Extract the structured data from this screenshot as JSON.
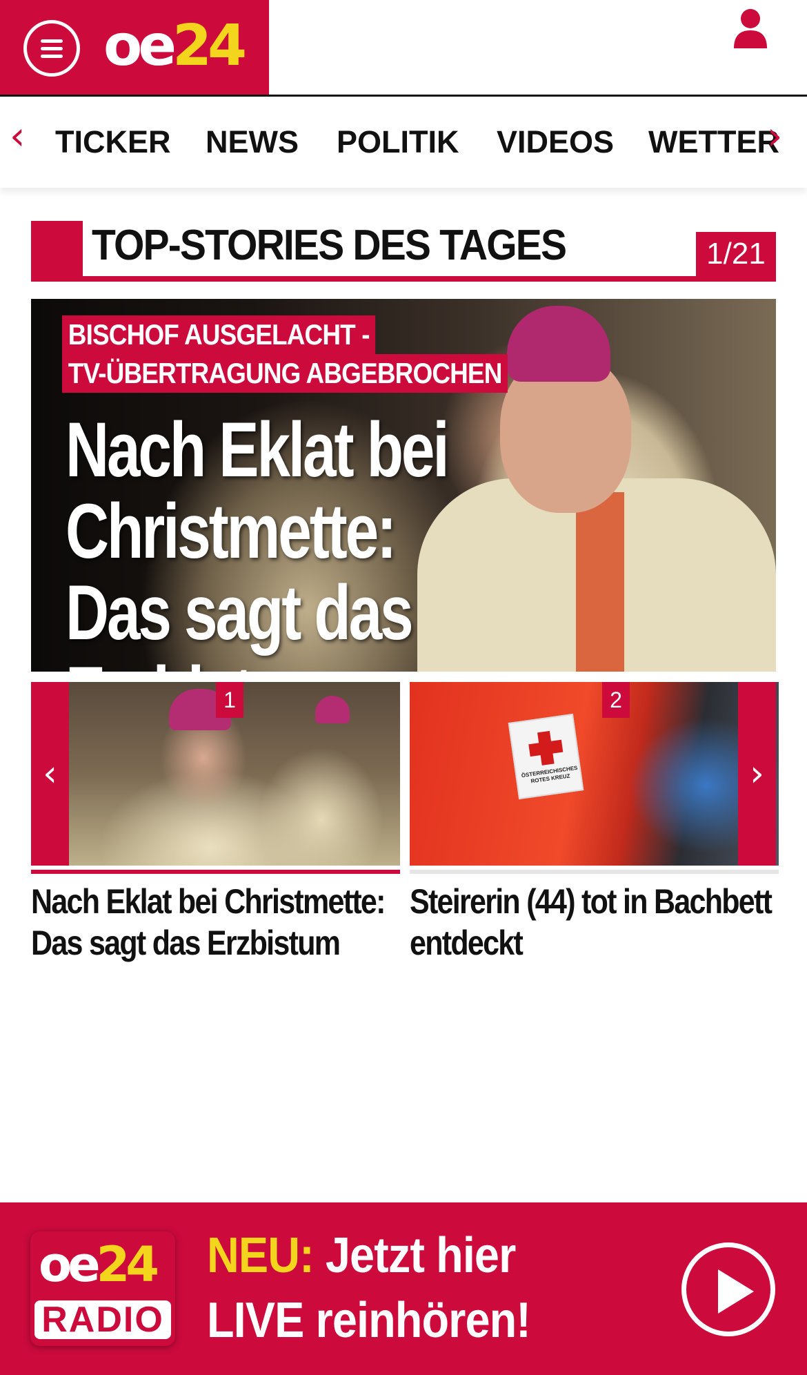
{
  "header": {
    "logo_oe": "oe",
    "logo_num": "24",
    "accent_color": "#cc0a3c",
    "logo_yellow": "#f4d51e",
    "icons": [
      "menu-icon",
      "user-icon"
    ]
  },
  "nav": {
    "items": [
      "TICKER",
      "NEWS",
      "POLITIK",
      "VIDEOS",
      "WETTER"
    ],
    "arrow_left": "‹",
    "arrow_right": "›"
  },
  "section": {
    "title": "TOP-STORIES DES TAGES",
    "counter": "1/21"
  },
  "hero": {
    "tag_line1": "BISCHOF AUSGELACHT -",
    "tag_line2": "TV-ÜBERTRAGUNG ABGEBROCHEN",
    "headline": "Nach Eklat bei Christmette: Das sagt das Erzbistum"
  },
  "carousel": {
    "arrow_left": "‹",
    "arrow_right": "›",
    "cards": [
      {
        "badge": "1",
        "title": "Nach Eklat bei Christmette: Das sagt das Erzbistum"
      },
      {
        "badge": "2",
        "title": "Steirerin (44) tot in Bachbett entdeckt",
        "patch_text": "ÖSTERREICHISCHES ROTES KREUZ"
      }
    ]
  },
  "radio": {
    "logo_oe": "oe",
    "logo_num": "24",
    "logo_label": "RADIO",
    "neu": "NEU:",
    "line1_rest": " Jetzt hier",
    "line2": "LIVE reinhören!"
  }
}
